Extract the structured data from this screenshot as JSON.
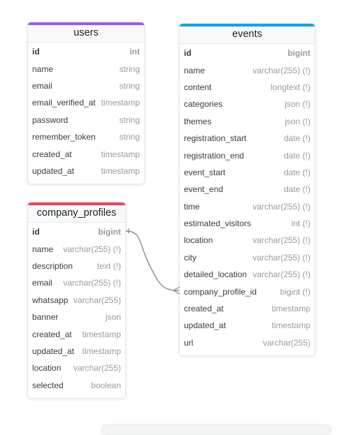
{
  "colors": {
    "users": "#9b5de5",
    "events": "#0ea5e9",
    "company_profiles": "#f0445a",
    "relation_line": "#8a8a8a"
  },
  "tables": {
    "users": {
      "name": "users",
      "fields": [
        {
          "name": "id",
          "type": "int"
        },
        {
          "name": "name",
          "type": "string"
        },
        {
          "name": "email",
          "type": "string"
        },
        {
          "name": "email_verified_at",
          "type": "timestamp"
        },
        {
          "name": "password",
          "type": "string"
        },
        {
          "name": "remember_token",
          "type": "string"
        },
        {
          "name": "created_at",
          "type": "timestamp"
        },
        {
          "name": "updated_at",
          "type": "timestamp"
        }
      ]
    },
    "company_profiles": {
      "name": "company_profiles",
      "fields": [
        {
          "name": "id",
          "type": "bigint"
        },
        {
          "name": "name",
          "type": "varchar(255) (!)"
        },
        {
          "name": "description",
          "type": "text (!)"
        },
        {
          "name": "email",
          "type": "varchar(255) (!)"
        },
        {
          "name": "whatsapp",
          "type": "varchar(255)"
        },
        {
          "name": "banner",
          "type": "json"
        },
        {
          "name": "created_at",
          "type": "timestamp"
        },
        {
          "name": "updated_at",
          "type": "timestamp"
        },
        {
          "name": "location",
          "type": "varchar(255)"
        },
        {
          "name": "selected",
          "type": "boolean"
        }
      ]
    },
    "events": {
      "name": "events",
      "fields": [
        {
          "name": "id",
          "type": "bigint"
        },
        {
          "name": "name",
          "type": "varchar(255) (!)"
        },
        {
          "name": "content",
          "type": "longtext (!)"
        },
        {
          "name": "categories",
          "type": "json (!)"
        },
        {
          "name": "themes",
          "type": "json (!)"
        },
        {
          "name": "registration_start",
          "type": "date (!)"
        },
        {
          "name": "registration_end",
          "type": "date (!)"
        },
        {
          "name": "event_start",
          "type": "date (!)"
        },
        {
          "name": "event_end",
          "type": "date (!)"
        },
        {
          "name": "time",
          "type": "varchar(255) (!)"
        },
        {
          "name": "estimated_visitors",
          "type": "int (!)"
        },
        {
          "name": "location",
          "type": "varchar(255) (!)"
        },
        {
          "name": "city",
          "type": "varchar(255) (!)"
        },
        {
          "name": "detailed_location",
          "type": "varchar(255) (!)"
        },
        {
          "name": "company_profile_id",
          "type": "bigint (!)"
        },
        {
          "name": "created_at",
          "type": "timestamp"
        },
        {
          "name": "updated_at",
          "type": "timestamp"
        },
        {
          "name": "url",
          "type": "varchar(255)"
        }
      ]
    }
  }
}
